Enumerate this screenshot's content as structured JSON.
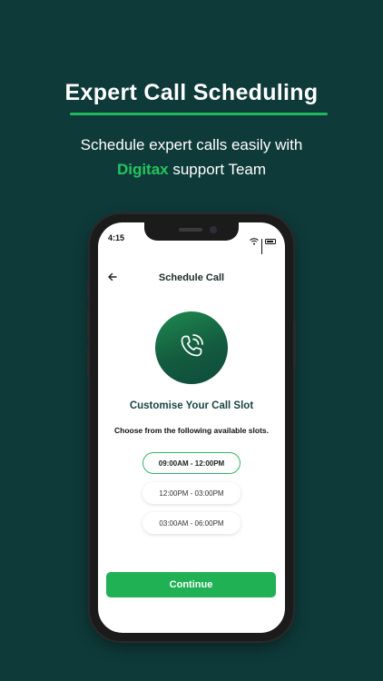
{
  "hero": {
    "title": "Expert Call Scheduling",
    "subtitle_line1": "Schedule expert calls easily with",
    "brand": "Digitax",
    "subtitle_line2_rest": " support Team"
  },
  "status_bar": {
    "time": "4:15",
    "icons": [
      "wifi-icon",
      "signal-icon",
      "battery-icon"
    ]
  },
  "nav": {
    "back_icon": "arrow-left-icon",
    "title": "Schedule Call"
  },
  "call_illustration": {
    "icon": "phone-call-icon"
  },
  "content": {
    "title": "Customise Your Call Slot",
    "subtitle": "Choose from the following available slots."
  },
  "slots": [
    {
      "label": "09:00AM - 12:00PM",
      "selected": true
    },
    {
      "label": "12:00PM - 03:00PM",
      "selected": false
    },
    {
      "label": "03:00AM - 06:00PM",
      "selected": false
    }
  ],
  "cta": {
    "label": "Continue"
  },
  "colors": {
    "background": "#0f3a3a",
    "accent": "#22c55e",
    "button": "#1fb153",
    "icon_circle": "#135b3f"
  }
}
